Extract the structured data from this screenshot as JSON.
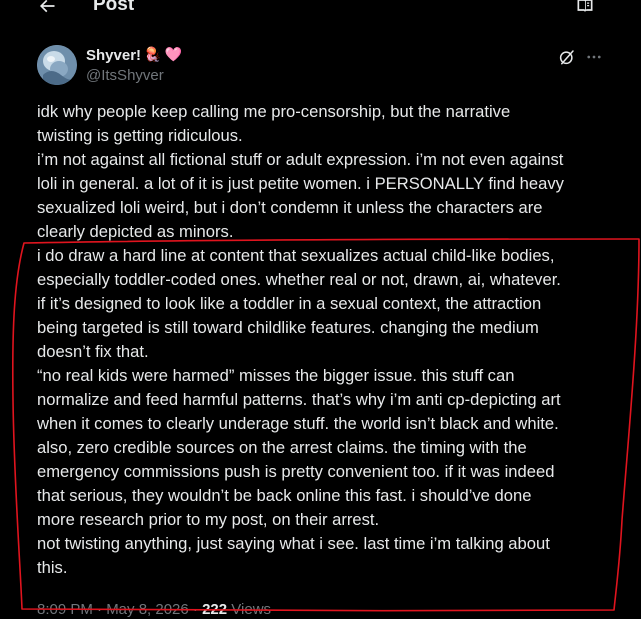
{
  "header": {
    "title": "Post",
    "back_icon": "arrow-left-icon",
    "reader_icon": "reader-view-icon"
  },
  "author": {
    "display_name": "Shyver!",
    "emoji_1": "🪼",
    "emoji_2": "🩷",
    "handle": "@ItsShyver"
  },
  "post": {
    "paragraphs": [
      "idk why people keep calling me pro-censorship, but the narrative\ntwisting is getting ridiculous.",
      "i’m not against all fictional stuff or adult expression. i’m not even against\nloli in general. a lot of it is just petite women. i PERSONALLY find heavy\nsexualized loli weird, but i don’t condemn it unless the characters are\nclearly depicted as minors.",
      "i do draw a hard line at content that sexualizes actual child-like bodies,\nespecially toddler-coded ones. whether real or not, drawn, ai, whatever.\nif it’s designed to look like a toddler in a sexual context, the attraction\nbeing targeted is still toward childlike features. changing the medium\ndoesn’t fix that.",
      "“no real kids were harmed” misses the bigger issue. this stuff can\nnormalize and feed harmful patterns. that’s why i’m anti cp-depicting art\nwhen it comes to clearly underage stuff. the world isn’t black and white.",
      "also, zero credible sources on the arrest claims. the timing with the\nemergency commissions push is pretty convenient too. if it was indeed\nthat serious, they wouldn’t be back online this fast. i should’ve done\nmore research prior to my post, on their arrest.",
      "not twisting anything, just saying what i see. last time i’m talking about\nthis."
    ]
  },
  "meta": {
    "time": "8:09 PM · May 8, 2026 ·",
    "views_count": "222",
    "views_label": "Views"
  },
  "colors": {
    "background": "#000000",
    "text": "#e7e9ea",
    "secondary": "#71767b",
    "annotation": "#e0141e"
  }
}
